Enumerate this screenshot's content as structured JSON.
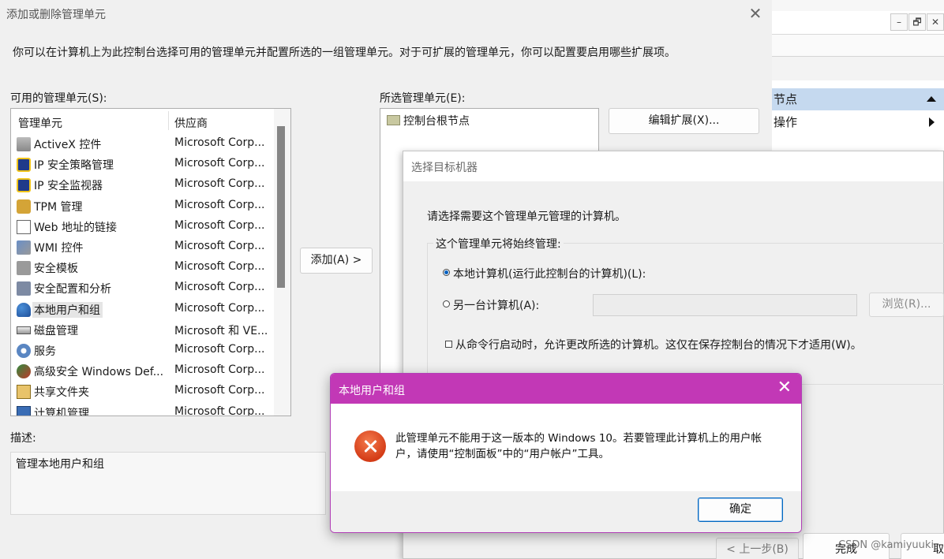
{
  "background_window": {
    "actions_header": "节点",
    "actions_item": "操作"
  },
  "main_dialog": {
    "title": "添加或删除管理单元",
    "intro": "你可以在计算机上为此控制台选择可用的管理单元并配置所选的一组管理单元。对于可扩展的管理单元，你可以配置要启用哪些扩展项。",
    "available_label": "可用的管理单元(S):",
    "columns": [
      "管理单元",
      "供应商"
    ],
    "snapins": [
      {
        "name": "ActiveX 控件",
        "vendor": "Microsoft Corp...",
        "icon": "activex-icon"
      },
      {
        "name": "IP 安全策略管理",
        "vendor": "Microsoft Corp...",
        "icon": "ipsec-policy-icon"
      },
      {
        "name": "IP 安全监视器",
        "vendor": "Microsoft Corp...",
        "icon": "ipsec-monitor-icon"
      },
      {
        "name": "TPM 管理",
        "vendor": "Microsoft Corp...",
        "icon": "tpm-icon"
      },
      {
        "name": "Web 地址的链接",
        "vendor": "Microsoft Corp...",
        "icon": "web-link-icon"
      },
      {
        "name": "WMI 控件",
        "vendor": "Microsoft Corp...",
        "icon": "wmi-icon"
      },
      {
        "name": "安全模板",
        "vendor": "Microsoft Corp...",
        "icon": "security-template-icon"
      },
      {
        "name": "安全配置和分析",
        "vendor": "Microsoft Corp...",
        "icon": "security-config-icon"
      },
      {
        "name": "本地用户和组",
        "vendor": "Microsoft Corp...",
        "icon": "users-groups-icon"
      },
      {
        "name": "磁盘管理",
        "vendor": "Microsoft 和 VE...",
        "icon": "disk-icon"
      },
      {
        "name": "服务",
        "vendor": "Microsoft Corp...",
        "icon": "services-gear-icon"
      },
      {
        "name": "高级安全 Windows Def...",
        "vendor": "Microsoft Corp...",
        "icon": "firewall-icon"
      },
      {
        "name": "共享文件夹",
        "vendor": "Microsoft Corp...",
        "icon": "shared-folder-icon"
      },
      {
        "name": "计算机管理",
        "vendor": "Microsoft Corp...",
        "icon": "computer-mgmt-icon"
      }
    ],
    "add_button": "添加(A) >",
    "selected_label": "所选管理单元(E):",
    "selected_root": "控制台根节点",
    "edit_ext_button": "编辑扩展(X)...",
    "desc_label": "描述:",
    "desc_text": "管理本地用户和组"
  },
  "target_dialog": {
    "title": "选择目标机器",
    "prompt": "请选择需要这个管理单元管理的计算机。",
    "group_label": "这个管理单元将始终管理:",
    "radio_local": "本地计算机(运行此控制台的计算机)(L):",
    "radio_other": "另一台计算机(A):",
    "other_computer_value": "",
    "browse_button": "浏览(R)...",
    "checkbox_label": "从命令行启动时，允许更改所选的计算机。这仅在保存控制台的情况下才适用(W)。",
    "back_button": "< 上一步(B)",
    "finish_button": "完成",
    "cancel_partial": "取"
  },
  "error_dialog": {
    "title": "本地用户和组",
    "message": "此管理单元不能用于这一版本的 Windows 10。若要管理此计算机上的用户帐户，请使用“控制面板”中的“用户帐户”工具。",
    "ok_button": "确定"
  },
  "watermark": "CSDN @kamiyuuki",
  "colors": {
    "error_titlebar": "#c238b6",
    "selection_header": "#c5d9ef",
    "error_icon": "#d43c17",
    "ok_border": "#0067c0"
  }
}
